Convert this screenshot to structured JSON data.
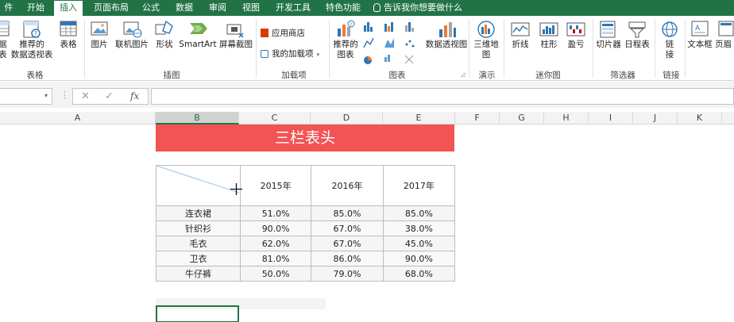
{
  "tabs": [
    {
      "label": "件",
      "active": false
    },
    {
      "label": "开始",
      "active": false
    },
    {
      "label": "插入",
      "active": true
    },
    {
      "label": "页面布局",
      "active": false
    },
    {
      "label": "公式",
      "active": false
    },
    {
      "label": "数据",
      "active": false
    },
    {
      "label": "审阅",
      "active": false
    },
    {
      "label": "视图",
      "active": false
    },
    {
      "label": "开发工具",
      "active": false
    },
    {
      "label": "特色功能",
      "active": false
    }
  ],
  "tell_me": "告诉我你想要做什么",
  "ribbon": {
    "pivot_line1": "据",
    "pivot_line2": "表",
    "recommended_pivot_line1": "推荐的",
    "recommended_pivot_line2": "数据透视表",
    "table": "表格",
    "pictures": "图片",
    "online_pictures": "联机图片",
    "shapes": "形状",
    "smartart": "SmartArt",
    "screenshot": "屏幕截图",
    "app_store": "应用商店",
    "my_addins": "我的加载项",
    "recommended_charts_line1": "推荐的",
    "recommended_charts_line2": "图表",
    "pivot_chart": "数据透视图",
    "map3d_line1": "三维地",
    "map3d_line2": "图",
    "line": "折线",
    "column": "柱形",
    "winloss": "盈亏",
    "slicer": "切片器",
    "timeline": "日程表",
    "link_line1": "链",
    "link_line2": "接",
    "textbox": "文本框",
    "header_footer": "页眉",
    "groups": {
      "tables": "表格",
      "illustrations": "插图",
      "addins": "加载项",
      "charts": "图表",
      "tours": "演示",
      "sparklines": "迷你图",
      "filters": "筛选器",
      "links": "链接"
    }
  },
  "formula": {
    "cancel": "✕",
    "enter": "✓",
    "fx": "fx",
    "value": ""
  },
  "columns": [
    {
      "label": "A",
      "selected": false
    },
    {
      "label": "B",
      "selected": true
    },
    {
      "label": "C",
      "selected": false
    },
    {
      "label": "D",
      "selected": false
    },
    {
      "label": "E",
      "selected": false
    },
    {
      "label": "F",
      "selected": false
    },
    {
      "label": "G",
      "selected": false
    },
    {
      "label": "H",
      "selected": false
    },
    {
      "label": "I",
      "selected": false
    },
    {
      "label": "J",
      "selected": false
    },
    {
      "label": "K",
      "selected": false
    }
  ],
  "sheet": {
    "title": "三栏表头",
    "years": [
      "2015年",
      "2016年",
      "2017年"
    ],
    "rows": [
      {
        "name": "连衣裙",
        "values": [
          "51.0%",
          "85.0%",
          "85.0%"
        ]
      },
      {
        "name": "针织衫",
        "values": [
          "90.0%",
          "67.0%",
          "38.0%"
        ]
      },
      {
        "name": "毛衣",
        "values": [
          "62.0%",
          "67.0%",
          "45.0%"
        ]
      },
      {
        "name": "卫衣",
        "values": [
          "81.0%",
          "86.0%",
          "90.0%"
        ]
      },
      {
        "name": "牛仔裤",
        "values": [
          "50.0%",
          "79.0%",
          "68.0%"
        ]
      }
    ]
  },
  "colors": {
    "accent": "#217346",
    "title_band": "#f25454"
  }
}
